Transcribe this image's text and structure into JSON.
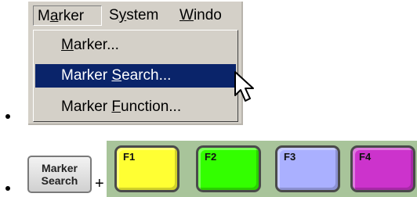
{
  "menubar": {
    "items": [
      {
        "label_pre": "M",
        "label_u": "a",
        "label_post": "rker"
      },
      {
        "label_pre": "S",
        "label_u": "y",
        "label_post": "stem"
      },
      {
        "label_pre": "",
        "label_u": "W",
        "label_post": "indo"
      }
    ]
  },
  "dropdown": {
    "items": [
      {
        "label_pre": "",
        "label_u": "M",
        "label_post": "arker..."
      },
      {
        "label_pre": "Marker ",
        "label_u": "S",
        "label_post": "earch..."
      },
      {
        "label_pre": "Marker ",
        "label_u": "F",
        "label_post": "unction..."
      }
    ]
  },
  "keys": {
    "marker_search": {
      "line1": "Marker",
      "line2": "Search"
    },
    "plus": "+",
    "function_keys": [
      {
        "label": "F1",
        "color": "#ffff33"
      },
      {
        "label": "F2",
        "color": "#33ff00"
      },
      {
        "label": "F3",
        "color": "#aab0ff"
      },
      {
        "label": "F4",
        "color": "#cc33cc"
      }
    ]
  }
}
